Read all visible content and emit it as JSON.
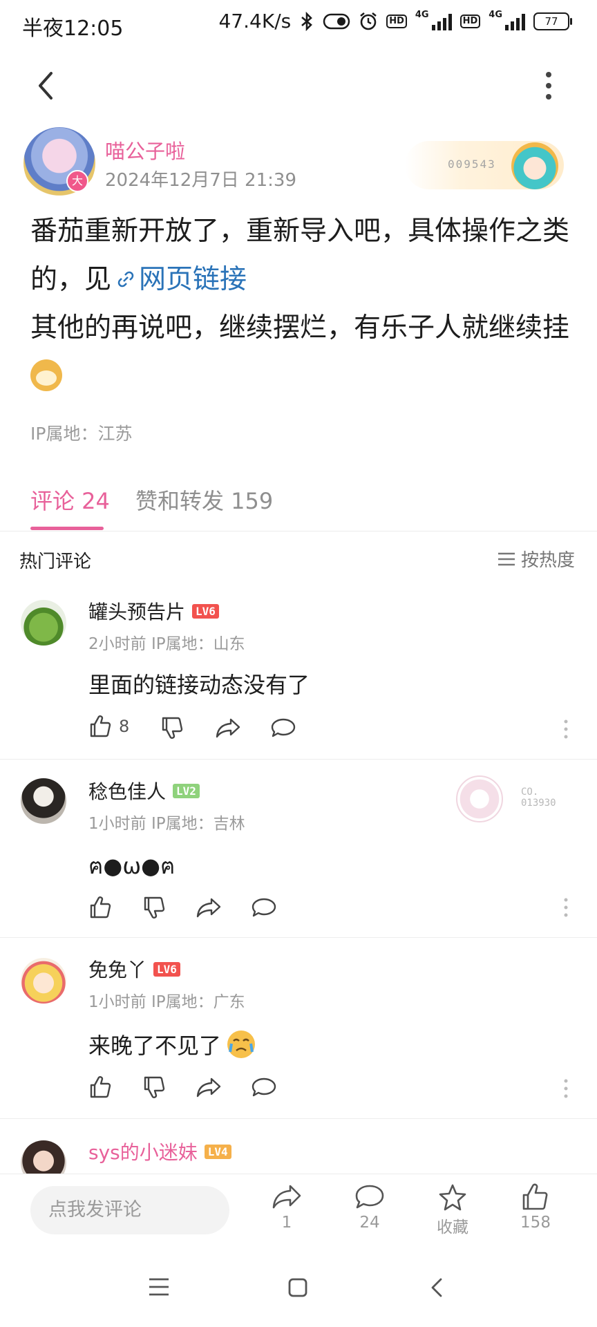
{
  "status_bar": {
    "time": "半夜12:05",
    "speed": "47.4K/s",
    "battery": "77"
  },
  "post": {
    "author": "喵公子啦",
    "author_badge": "大",
    "time": "2024年12月7日 21:39",
    "fan_card_number": "009543",
    "text_line1": "番茄重新开放了，重新导入吧，具体操作之类的，见",
    "link_text": "网页链接",
    "text_line2": "其他的再说吧，继续摆烂，有乐子人就继续挂",
    "ip": "IP属地：江苏"
  },
  "tabs": [
    {
      "label": "评论 24",
      "active": true
    },
    {
      "label": "赞和转发 159",
      "active": false
    }
  ],
  "comments_header": {
    "title": "热门评论",
    "sort_label": "按热度"
  },
  "comments": [
    {
      "name": "罐头预告片",
      "level": "LV6",
      "level_color": "#f2524e",
      "meta": "2小时前 IP属地：山东",
      "text": "里面的链接动态没有了",
      "likes": "8"
    },
    {
      "name": "稔色佳人",
      "level": "LV2",
      "level_color": "#8fd27c",
      "meta": "1小时前 IP属地：吉林",
      "text": "ฅ●ω●ฅ",
      "likes": "",
      "fan_card_no": "CO.\n013930"
    },
    {
      "name": "免免丫",
      "level": "LV6",
      "level_color": "#f2524e",
      "meta": "1小时前 IP属地：广东",
      "text": "来晚了不见了",
      "likes": ""
    },
    {
      "name": "sys的小迷妹",
      "level": "LV4",
      "level_color": "#f5b04a",
      "meta": "",
      "text": "",
      "likes": ""
    }
  ],
  "bottom_bar": {
    "input_placeholder": "点我发评论",
    "share_count": "1",
    "comment_count": "24",
    "favorite_label": "收藏",
    "like_count": "158"
  },
  "colors": {
    "accent": "#e8619a",
    "link": "#2a73b8"
  }
}
